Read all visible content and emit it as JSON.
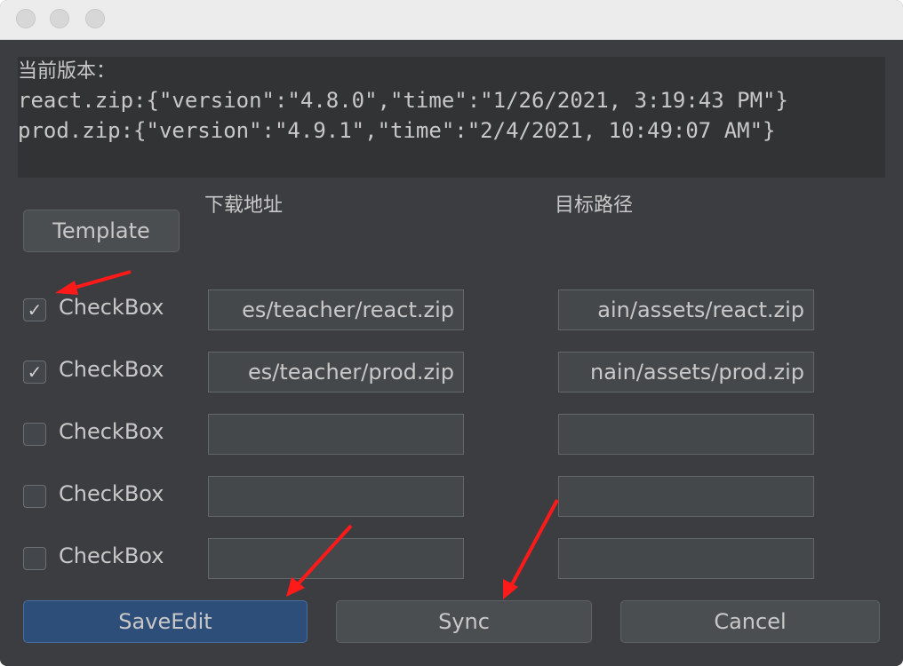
{
  "window": {
    "controls": [
      "close-button",
      "minimize-button",
      "zoom-button"
    ]
  },
  "version_info": {
    "heading": "当前版本：",
    "lines": [
      "react.zip:{\"version\":\"4.8.0\",\"time\":\"1/26/2021, 3:19:43 PM\"}",
      "prod.zip:{\"version\":\"4.9.1\",\"time\":\"2/4/2021, 10:49:07 AM\"}"
    ]
  },
  "columns": {
    "download_url": "下载地址",
    "target_path": "目标路径"
  },
  "template_button": "Template",
  "rows": [
    {
      "checked": true,
      "label": "CheckBox",
      "url": "es/teacher/react.zip",
      "path": "ain/assets/react.zip"
    },
    {
      "checked": true,
      "label": "CheckBox",
      "url": "es/teacher/prod.zip",
      "path": "nain/assets/prod.zip"
    },
    {
      "checked": false,
      "label": "CheckBox",
      "url": "",
      "path": ""
    },
    {
      "checked": false,
      "label": "CheckBox",
      "url": "",
      "path": ""
    },
    {
      "checked": false,
      "label": "CheckBox",
      "url": "",
      "path": ""
    }
  ],
  "buttons": {
    "save_edit": "SaveEdit",
    "sync": "Sync",
    "cancel": "Cancel"
  },
  "colors": {
    "window_bg": "#3b3d40",
    "panel_bg": "#313335",
    "primary_button": "#2e4e7a",
    "annotation_arrow": "#ff1a1a"
  }
}
